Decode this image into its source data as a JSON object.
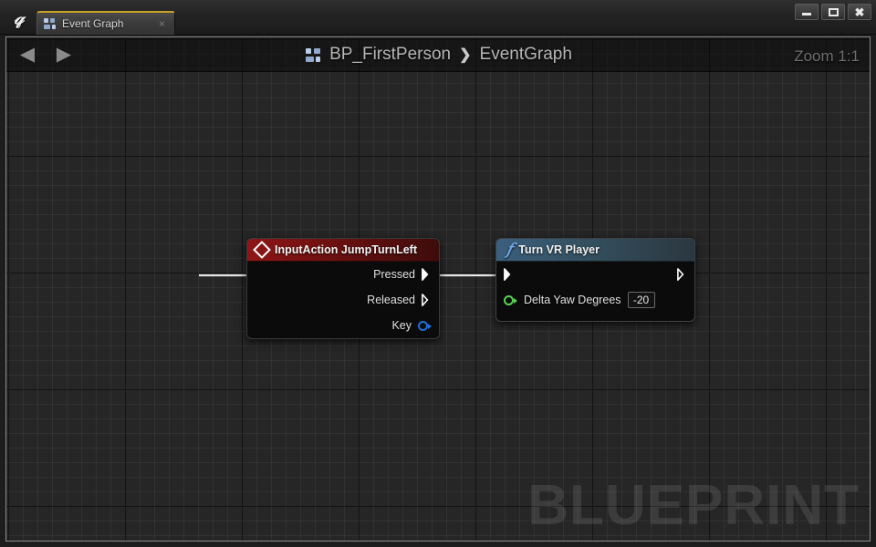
{
  "window": {
    "logo": "unreal-engine-logo",
    "controls": {
      "minimize": "minimize-icon",
      "maximize": "maximize-icon",
      "close": "close-icon"
    }
  },
  "tab": {
    "label": "Event Graph",
    "icon": "blueprint-icon",
    "close": "×",
    "active_accent": "#c9a227"
  },
  "toolbar": {
    "back": "◀",
    "forward": "▶",
    "zoom_label": "Zoom 1:1"
  },
  "breadcrumb": {
    "icon": "blueprint-icon",
    "root": "BP_FirstPerson",
    "separator": "❯",
    "current": "EventGraph"
  },
  "canvas": {
    "watermark": "BLUEPRINT",
    "background": "#262626",
    "grid_minor": "rgba(255,255,255,0.05)",
    "grid_major": "rgba(0,0,0,0.85)"
  },
  "nodes": [
    {
      "id": "inputaction",
      "title": "InputAction JumpTurnLeft",
      "icon": "input-event-diamond-icon",
      "header_color": "#8e1616",
      "pins": [
        {
          "label": "Pressed",
          "kind": "exec",
          "filled": true,
          "side": "output"
        },
        {
          "label": "Released",
          "kind": "exec",
          "filled": false,
          "side": "output"
        },
        {
          "label": "Key",
          "kind": "data",
          "color": "#1e6fd9",
          "side": "output"
        }
      ]
    },
    {
      "id": "turnvrplayer",
      "title": "Turn VR Player",
      "icon": "function-f-icon",
      "header_color": "#3b5f7d",
      "pins": [
        {
          "label": "",
          "kind": "exec",
          "filled": true,
          "side": "input"
        },
        {
          "label": "",
          "kind": "exec",
          "filled": false,
          "side": "output"
        },
        {
          "label": "Delta Yaw Degrees",
          "kind": "data",
          "color": "#58d354",
          "side": "input",
          "value": "-20"
        }
      ]
    }
  ],
  "connection": {
    "from": "InputAction JumpTurnLeft.Pressed",
    "to": "Turn VR Player.exec-in",
    "color": "#e8e8e8"
  }
}
